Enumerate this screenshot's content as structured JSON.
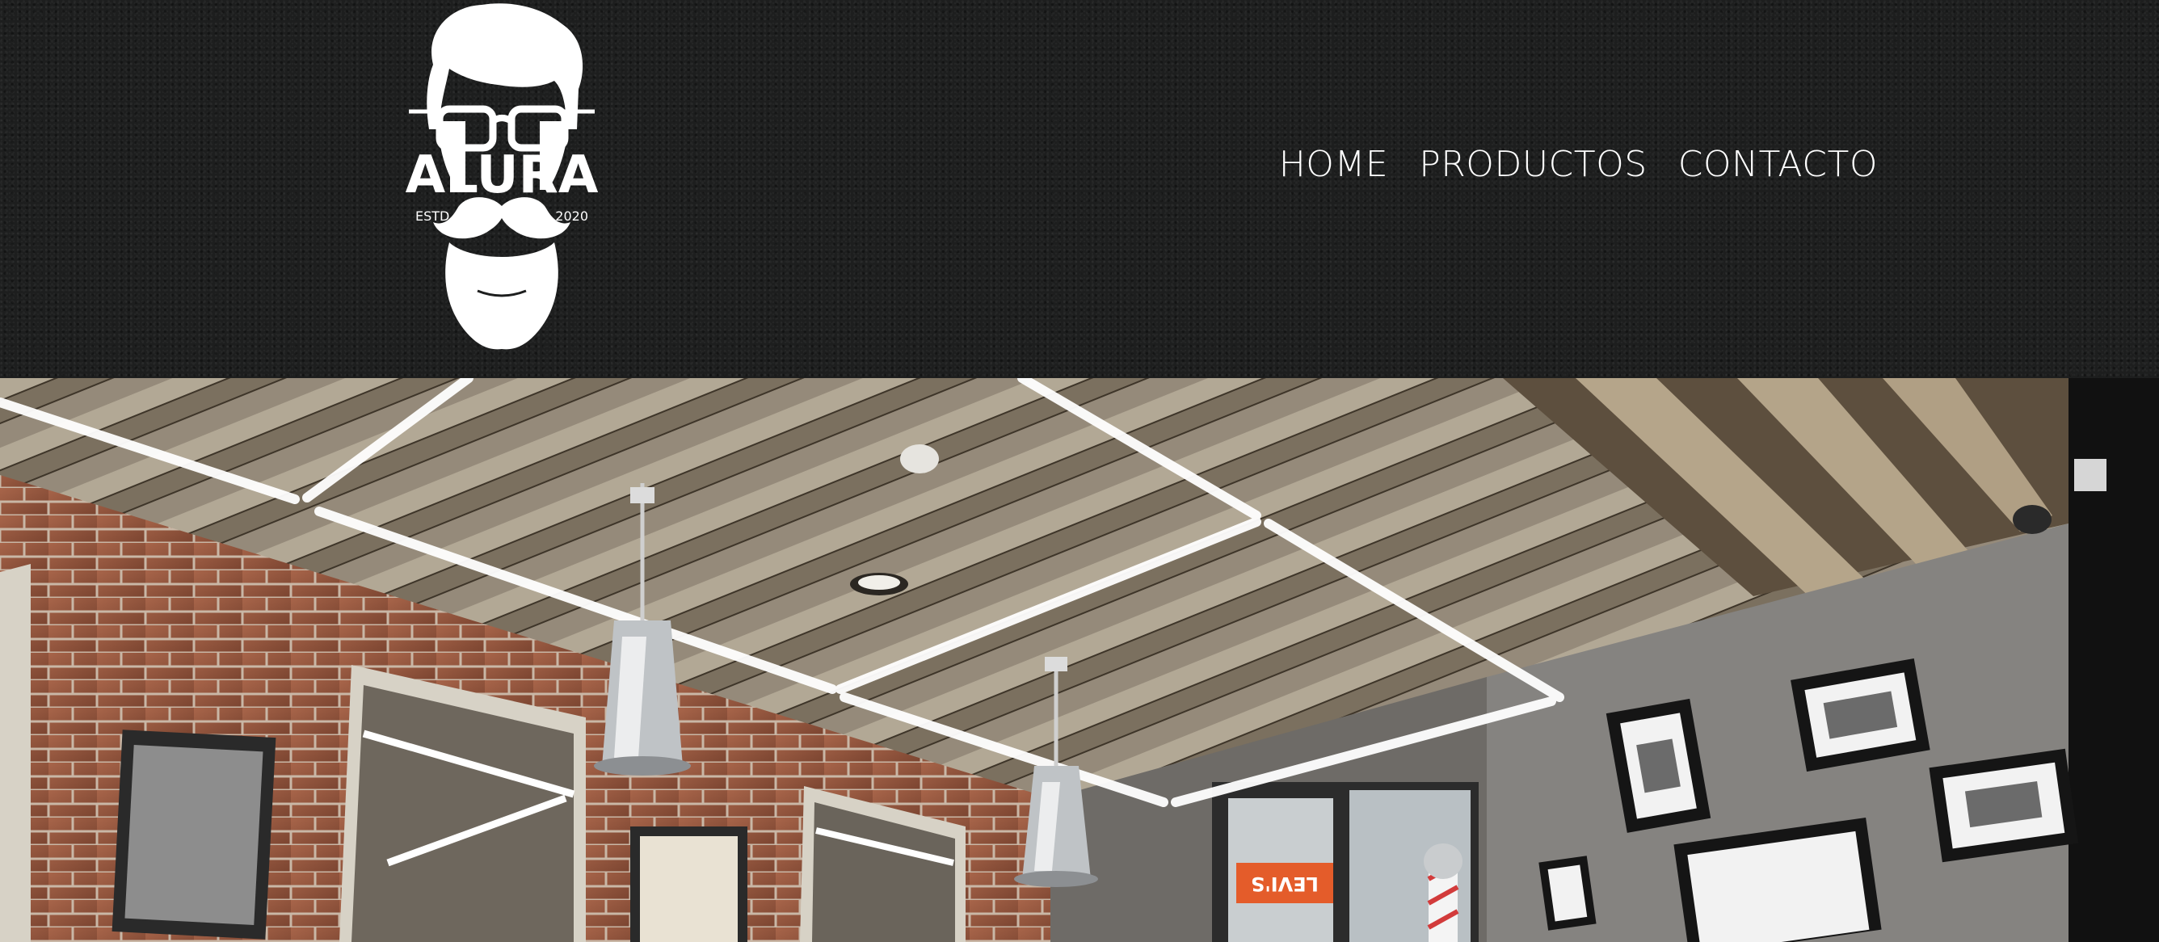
{
  "brand": {
    "logo_text": "ALURA",
    "logo_left_text": "ESTD",
    "logo_right_text": "2020",
    "logo_icon": "bearded-man-with-glasses-icon"
  },
  "nav": {
    "items": [
      {
        "label": "HOME"
      },
      {
        "label": "PRODUCTOS"
      },
      {
        "label": "CONTACTO"
      }
    ]
  },
  "hero": {
    "description": "barbershop interior photo",
    "sign_text": "LEVI'S"
  },
  "colors": {
    "header_bg": "#1d1e1e",
    "nav_text": "#ffffff",
    "brick": "#9a5a3d",
    "ceiling_wood": "#8f8576",
    "wall_gray": "#858380"
  }
}
